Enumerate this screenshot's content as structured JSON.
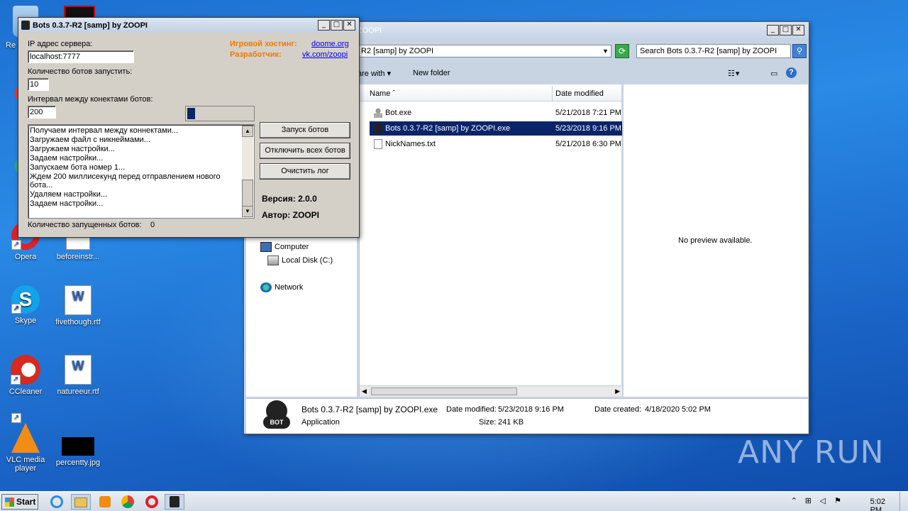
{
  "desktop": {
    "icons": [
      {
        "label": "Re",
        "id": "recycle"
      },
      {
        "label": "Opera",
        "id": "opera"
      },
      {
        "label": "beforeinstr...",
        "id": "beforeinstr"
      },
      {
        "label": "Skype",
        "id": "skype"
      },
      {
        "label": "fivethough.rtf",
        "id": "fivethough"
      },
      {
        "label": "CCleaner",
        "id": "ccleaner"
      },
      {
        "label": "natureeur.rtf",
        "id": "natureeur"
      },
      {
        "label": "VLC media player",
        "id": "vlc"
      },
      {
        "label": "percentty.jpg",
        "id": "percentty"
      }
    ]
  },
  "explorer": {
    "title": "ZOOPI",
    "address": "R2 [samp] by ZOOPI",
    "search_placeholder": "Search Bots 0.3.7-R2 [samp] by ZOOPI",
    "toolbar": {
      "share_with": "are with",
      "new_folder": "New folder"
    },
    "nav": {
      "computer": "Computer",
      "local_disk": "Local Disk (C:)",
      "network": "Network"
    },
    "columns": {
      "name": "Name",
      "date_modified": "Date modified"
    },
    "files": [
      {
        "name": "Bot.exe",
        "date": "5/21/2018 7:21 PM"
      },
      {
        "name": "Bots 0.3.7-R2 [samp] by ZOOPI.exe",
        "date": "5/23/2018 9:16 PM"
      },
      {
        "name": "NickNames.txt",
        "date": "5/21/2018 6:30 PM"
      }
    ],
    "preview_text": "No preview available.",
    "details": {
      "file_name": "Bots 0.3.7-R2 [samp] by ZOOPI.exe",
      "type": "Application",
      "date_modified_label": "Date modified:",
      "date_modified": "5/23/2018 9:16 PM",
      "size_label": "Size:",
      "size": "241 KB",
      "date_created_label": "Date created:",
      "date_created": "4/18/2020 5:02 PM",
      "bot_icon_text": "BOT"
    }
  },
  "bots_app": {
    "title": "Bots 0.3.7-R2 [samp] by ZOOPI",
    "server_ip_label": "IP адрес сервера:",
    "server_ip_value": "localhost:7777",
    "bot_count_label": "Количество ботов запустить:",
    "bot_count_value": "10",
    "interval_label": "Интервал между конектами ботов:",
    "interval_value": "200",
    "hosting_label": "Игровой хостинг:",
    "hosting_link": "doome.org",
    "developer_label": "Разработчик:",
    "developer_link": "vk.com/zoopi",
    "progress": 0.12,
    "log": [
      "Получаем интервал между коннектами...",
      "Загружаем файл с никнеймами...",
      "Загружаем настройки...",
      "Задаем настройки...",
      "Запускаем бота номер 1...",
      "Ждем 200 миллисекунд перед отправлением нового",
      "бота...",
      "Удаляем настройки...",
      "Задаем настройки..."
    ],
    "buttons": {
      "start": "Запуск ботов",
      "disconnect": "Отключить всех ботов",
      "clear": "Очистить лог"
    },
    "version_label": "Версия:",
    "version_value": "2.0.0",
    "author_label": "Автор:",
    "author_value": "ZOOPI",
    "running_label": "Количество запущенных ботов:",
    "running_value": "0"
  },
  "taskbar": {
    "start": "Start",
    "time": "5:02 PM"
  },
  "watermark": "ANY RUN"
}
